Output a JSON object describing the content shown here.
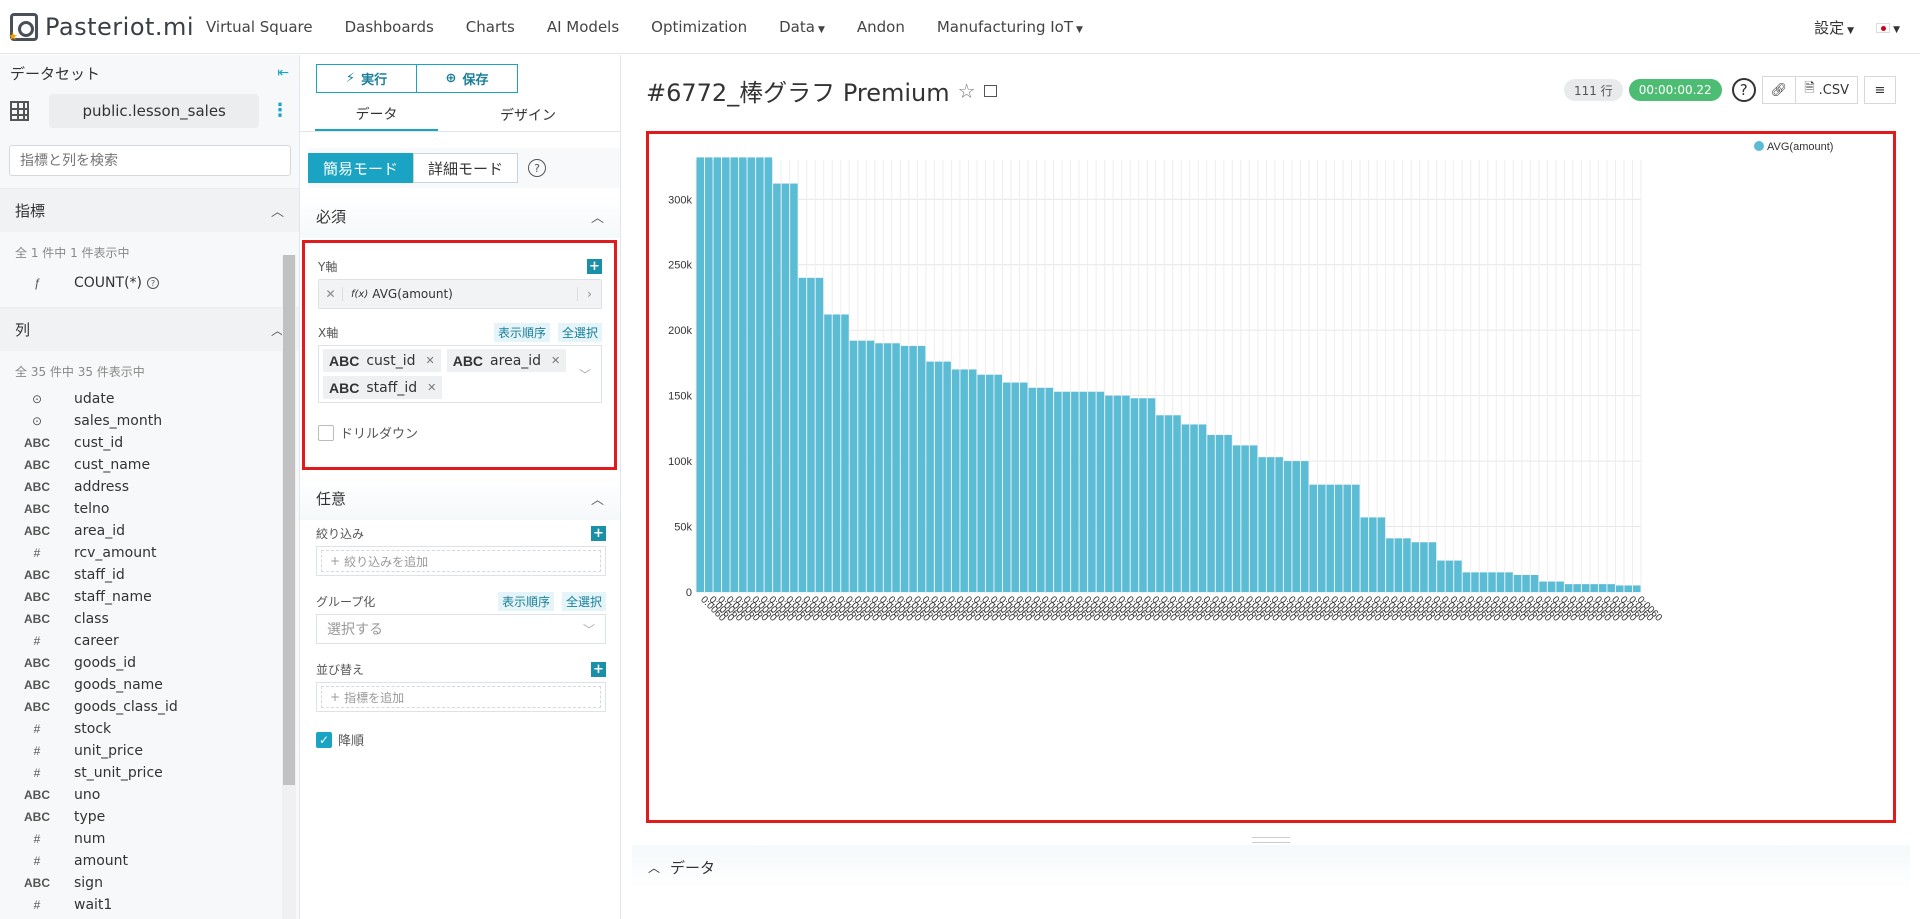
{
  "app": {
    "logo": "Pasteriot.mi"
  },
  "nav": {
    "items": [
      {
        "label": "Virtual Square"
      },
      {
        "label": "Dashboards"
      },
      {
        "label": "Charts"
      },
      {
        "label": "AI Models"
      },
      {
        "label": "Optimization"
      },
      {
        "label": "Data"
      },
      {
        "label": "Andon"
      },
      {
        "label": "Manufacturing IoT"
      }
    ],
    "settings": "設定"
  },
  "sidebar": {
    "title": "データセット",
    "dataset": "public.lesson_sales",
    "search_placeholder": "指標と列を検索",
    "metrics_title": "指標",
    "metrics_count": "全 1 件中 1 件表示中",
    "metrics": [
      {
        "type": "ƒ",
        "name": "COUNT(*)"
      }
    ],
    "columns_title": "列",
    "columns_count": "全 35 件中 35 件表示中",
    "columns": [
      {
        "type": "⊙",
        "name": "udate"
      },
      {
        "type": "⊙",
        "name": "sales_month"
      },
      {
        "type": "ABC",
        "name": "cust_id"
      },
      {
        "type": "ABC",
        "name": "cust_name"
      },
      {
        "type": "ABC",
        "name": "address"
      },
      {
        "type": "ABC",
        "name": "telno"
      },
      {
        "type": "ABC",
        "name": "area_id"
      },
      {
        "type": "#",
        "name": "rcv_amount"
      },
      {
        "type": "ABC",
        "name": "staff_id"
      },
      {
        "type": "ABC",
        "name": "staff_name"
      },
      {
        "type": "ABC",
        "name": "class"
      },
      {
        "type": "#",
        "name": "career"
      },
      {
        "type": "ABC",
        "name": "goods_id"
      },
      {
        "type": "ABC",
        "name": "goods_name"
      },
      {
        "type": "ABC",
        "name": "goods_class_id"
      },
      {
        "type": "#",
        "name": "stock"
      },
      {
        "type": "#",
        "name": "unit_price"
      },
      {
        "type": "#",
        "name": "st_unit_price"
      },
      {
        "type": "ABC",
        "name": "uno"
      },
      {
        "type": "ABC",
        "name": "type"
      },
      {
        "type": "#",
        "name": "num"
      },
      {
        "type": "#",
        "name": "amount"
      },
      {
        "type": "ABC",
        "name": "sign"
      },
      {
        "type": "#",
        "name": "wait1"
      }
    ]
  },
  "config": {
    "run": "実行",
    "save": "保存",
    "tab_data": "データ",
    "tab_design": "デザイン",
    "mode_simple": "簡易モード",
    "mode_advanced": "詳細モード",
    "required": "必須",
    "y_label": "Y軸",
    "y_value": "AVG(amount)",
    "x_label": "X軸",
    "sort_order": "表示順序",
    "select_all": "全選択",
    "x_fields": [
      {
        "type": "ABC",
        "name": "cust_id"
      },
      {
        "type": "ABC",
        "name": "area_id"
      },
      {
        "type": "ABC",
        "name": "staff_id"
      }
    ],
    "drilldown": "ドリルダウン",
    "optional": "任意",
    "filter_label": "絞り込み",
    "filter_placeholder": "絞り込みを追加",
    "group_label": "グループ化",
    "group_placeholder": "選択する",
    "sort_label": "並び替え",
    "sort_placeholder": "指標を追加",
    "desc": "降順"
  },
  "main": {
    "title": "#6772_棒グラフ Premium",
    "rows": "111 行",
    "time": "00:00:00.22",
    "csv": ".CSV",
    "data_panel": "データ"
  },
  "colors": {
    "accent": "#1aa3c2",
    "bar": "#5bbcd6",
    "highlight": "#e01b1b",
    "time_badge": "#4dbd74"
  },
  "chart_data": {
    "type": "bar",
    "legend": "AVG(amount)",
    "legend_position": "top-right",
    "grid": true,
    "ylim": [
      0,
      330000
    ],
    "yticks": [
      "0",
      "50k",
      "100k",
      "150k",
      "200k",
      "250k",
      "300k"
    ],
    "ytick_values": [
      0,
      50000,
      100000,
      150000,
      200000,
      250000,
      300000
    ],
    "values": [
      332000,
      332000,
      332000,
      332000,
      332000,
      332000,
      332000,
      332000,
      332000,
      312000,
      312000,
      312000,
      240000,
      240000,
      240000,
      212000,
      212000,
      212000,
      192000,
      192000,
      192000,
      190000,
      190000,
      190000,
      188000,
      188000,
      188000,
      176000,
      176000,
      176000,
      170000,
      170000,
      170000,
      166000,
      166000,
      166000,
      160000,
      160000,
      160000,
      156000,
      156000,
      156000,
      153000,
      153000,
      153000,
      153000,
      153000,
      153000,
      150000,
      150000,
      150000,
      148000,
      148000,
      148000,
      135000,
      135000,
      135000,
      128000,
      128000,
      128000,
      120000,
      120000,
      120000,
      112000,
      112000,
      112000,
      103000,
      103000,
      103000,
      100000,
      100000,
      100000,
      82000,
      82000,
      82000,
      82000,
      82000,
      82000,
      57000,
      57000,
      57000,
      41000,
      41000,
      41000,
      38000,
      38000,
      38000,
      24000,
      24000,
      24000,
      15000,
      15000,
      15000,
      15000,
      15000,
      15000,
      13000,
      13000,
      13000,
      8000,
      8000,
      8000,
      6000,
      6000,
      6000,
      6000,
      6000,
      6000,
      5000,
      5000,
      5000
    ],
    "category_prefix": "0:0060"
  }
}
